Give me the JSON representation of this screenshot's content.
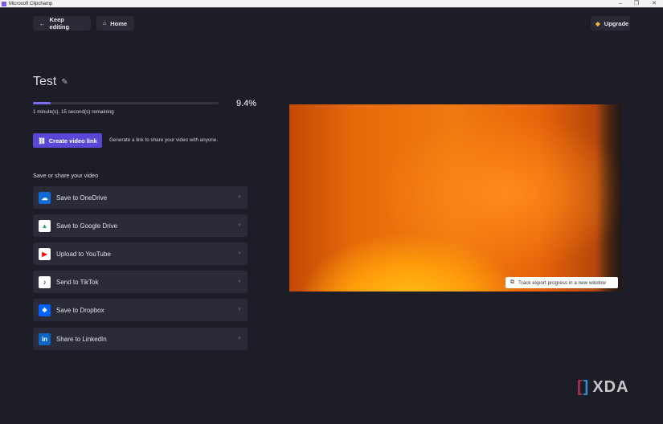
{
  "window": {
    "title": "Microsoft Clipchamp",
    "minimize": "–",
    "restore": "❐",
    "close": "✕"
  },
  "header": {
    "keep_editing": "Keep editing",
    "home": "Home",
    "upgrade": "Upgrade"
  },
  "project": {
    "title": "Test",
    "progress_percent": 9.4,
    "progress_label": "9.4%",
    "remaining": "1 minute(s), 15 second(s) remaining"
  },
  "share_link": {
    "button": "Create video link",
    "description": "Generate a link to share your video with anyone."
  },
  "save_section": {
    "heading": "Save or share your video",
    "items": [
      {
        "label": "Save to OneDrive",
        "icon": "onedrive-icon",
        "color": "#0f6cd6"
      },
      {
        "label": "Save to Google Drive",
        "icon": "google-drive-icon",
        "color": "#ffffff"
      },
      {
        "label": "Upload to YouTube",
        "icon": "youtube-icon",
        "color": "#ffffff"
      },
      {
        "label": "Send to TikTok",
        "icon": "tiktok-icon",
        "color": "#ffffff"
      },
      {
        "label": "Save to Dropbox",
        "icon": "dropbox-icon",
        "color": "#0061fe"
      },
      {
        "label": "Share to LinkedIn",
        "icon": "linkedin-icon",
        "color": "#0a66c2"
      }
    ]
  },
  "preview": {
    "track_button": "Track export progress in a new window"
  },
  "watermark": {
    "text": "XDA"
  },
  "colors": {
    "accent": "#5b47d6",
    "progress": "#7b6cf0",
    "background": "#1d1d27"
  }
}
